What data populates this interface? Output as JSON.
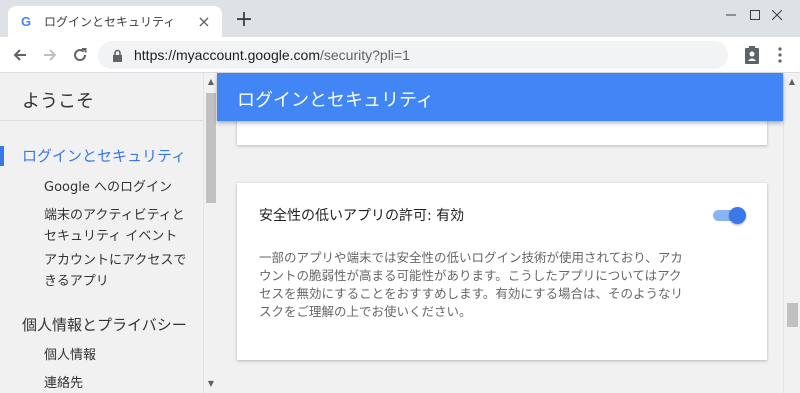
{
  "browser": {
    "tab_title": "ログインとセキュリティ",
    "tab_close": "×",
    "new_tab": "+",
    "url_host": "https://myaccount.google.com",
    "url_path": "/security?pli=1",
    "favicon_letter": "G"
  },
  "sidebar": {
    "welcome": "ようこそ",
    "sections": [
      {
        "label": "ログインとセキュリティ",
        "items": [
          "Google へのログイン",
          "端末のアクティビティと",
          "セキュリティ イベント",
          "アカウントにアクセスで",
          "きるアプリ"
        ]
      },
      {
        "label": "個人情報とプライバシー",
        "items": [
          "個人情報",
          "連絡先"
        ]
      }
    ]
  },
  "main": {
    "header": "ログインとセキュリティ",
    "setting": {
      "title": "安全性の低いアプリの許可: 有効",
      "description": "一部のアプリや端末では安全性の低いログイン技術が使用されており、アカウントの脆弱性が高まる可能性があります。こうしたアプリについてはアクセスを無効にすることをおすすめします。有効にする場合は、そのようなリスクをご理解の上でお使いください。",
      "enabled": true
    }
  },
  "colors": {
    "accent": "#4285f4",
    "active_link": "#3b78e7",
    "toggle_on": "#3b78e7"
  }
}
